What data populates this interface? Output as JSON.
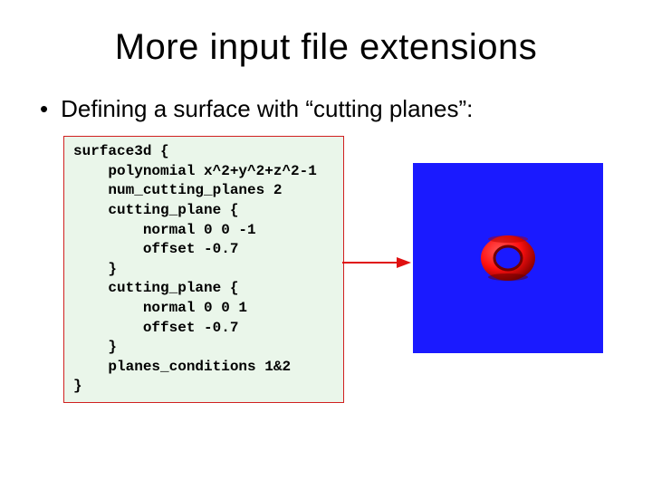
{
  "title": "More input file extensions",
  "bullet": "Defining a surface with “cutting planes”:",
  "code": "surface3d {\n    polynomial x^2+y^2+z^2-1\n    num_cutting_planes 2\n    cutting_plane {\n        normal 0 0 -1\n        offset -0.7\n    }\n    cutting_plane {\n        normal 0 0 1\n        offset -0.7\n    }\n    planes_conditions 1&2\n}",
  "colors": {
    "arrow": "#e01010",
    "code_border": "#d02020",
    "code_bg": "#eaf6ea",
    "render_bg": "#1a1aff",
    "ring_outer": "#ff1010",
    "ring_highlight": "#ff6060",
    "ring_shadow": "#900000"
  }
}
